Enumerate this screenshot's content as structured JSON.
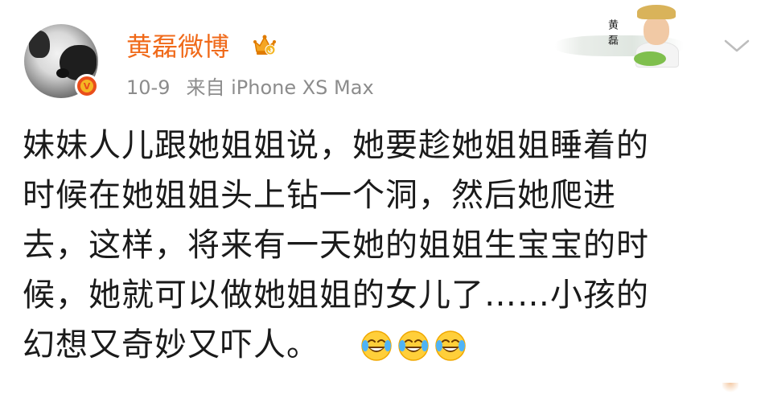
{
  "post": {
    "author": "黄磊微博",
    "date": "10-9",
    "source": "来自 iPhone XS Max",
    "content": "妹妹人儿跟她姐姐说，她要趁她姐姐睡着的\n时候在她姐姐头上钻一个洞，然后她爬进\n去，这样，将来有一天她的姐姐生宝宝的时\n候，她就可以做她姐姐的女儿了……小孩的\n幻想又奇妙又吓人。",
    "emojis": [
      "laugh-cry-emoji",
      "laugh-cry-emoji",
      "laugh-cry-emoji"
    ]
  },
  "card": {
    "signature": "黄磊"
  },
  "icons": {
    "verified": "verified-badge-icon",
    "vip": "vip-crown-icon",
    "more": "chevron-down-icon"
  },
  "colors": {
    "username": "#f06a1a",
    "meta": "#8c8c8c",
    "text": "#1a1a1a",
    "verified": "#e94e1b"
  }
}
